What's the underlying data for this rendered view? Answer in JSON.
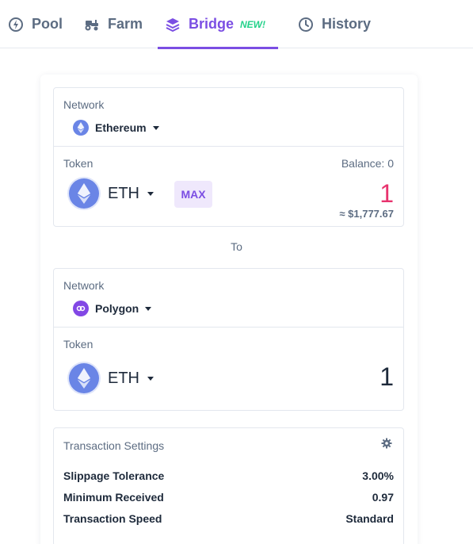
{
  "tabs": {
    "pool": "Pool",
    "farm": "Farm",
    "bridge": "Bridge",
    "bridge_badge": "NEW!",
    "history": "History"
  },
  "from": {
    "network_label": "Network",
    "network": "Ethereum",
    "token_label": "Token",
    "balance": "Balance: 0",
    "token": "ETH",
    "max_label": "MAX",
    "amount": "1",
    "usd_value": "≈ $1,777.67"
  },
  "to_label": "To",
  "to": {
    "network_label": "Network",
    "network": "Polygon",
    "token_label": "Token",
    "token": "ETH",
    "amount": "1"
  },
  "settings": {
    "title": "Transaction Settings",
    "rows": [
      {
        "label": "Slippage Tolerance",
        "value": "3.00%"
      },
      {
        "label": "Minimum Received",
        "value": "0.97"
      },
      {
        "label": "Transaction Speed",
        "value": "Standard"
      }
    ]
  },
  "colors": {
    "accent": "#7b4ee3",
    "new_badge": "#23d28a",
    "amount_highlight": "#e8336e",
    "ethereum": "#6a85e6",
    "polygon": "#8247e5"
  },
  "icons": {
    "pool": "droplet-bolt-icon",
    "farm": "tractor-icon",
    "bridge": "layers-icon",
    "history": "clock-icon",
    "settings": "gear-icon"
  }
}
